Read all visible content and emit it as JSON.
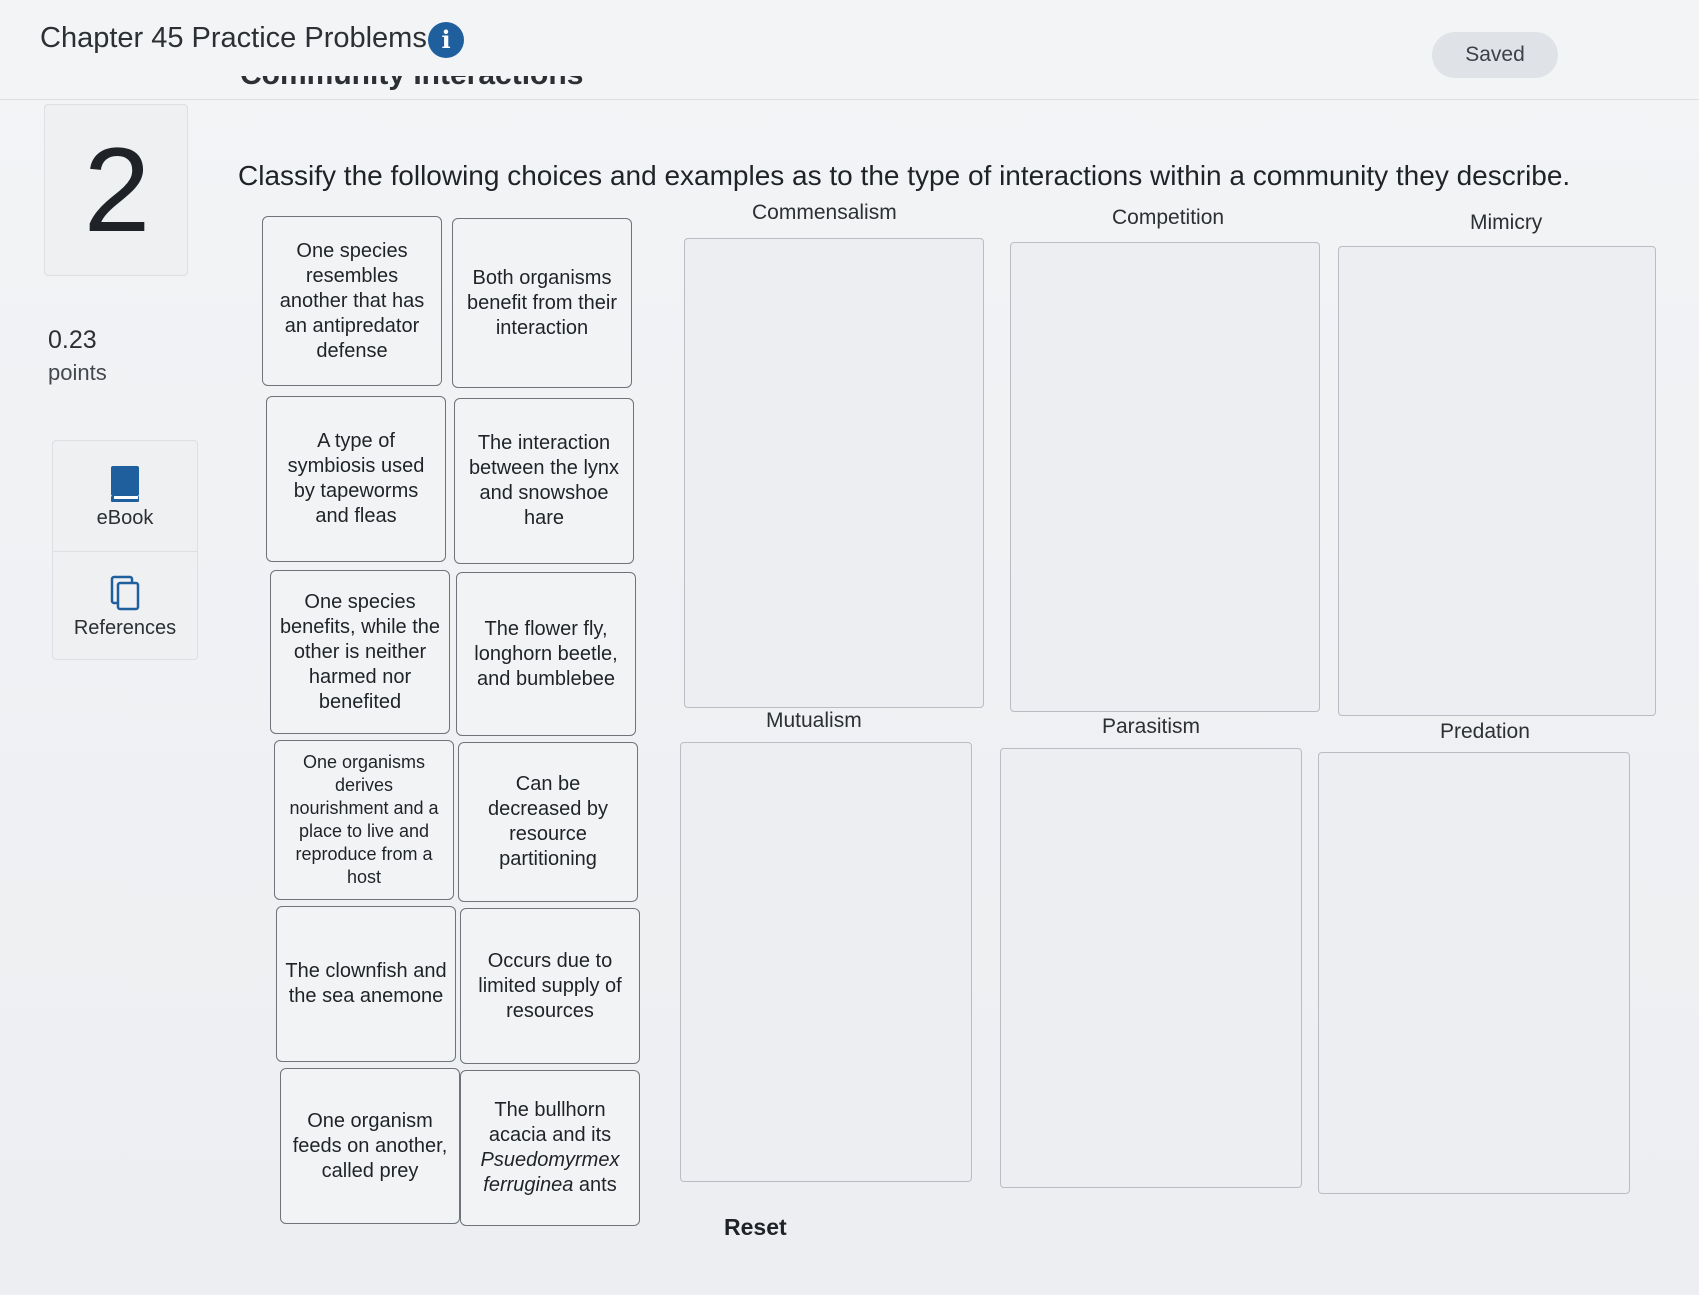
{
  "header": {
    "chapter_title": "Chapter 45 Practice Problems",
    "saved_label": "Saved",
    "section_heading": "Community Interactions"
  },
  "sidebar": {
    "question_number": "2",
    "points_value": "0.23",
    "points_label": "points",
    "tools": [
      {
        "label": "eBook",
        "icon": "book-icon"
      },
      {
        "label": "References",
        "icon": "documents-icon"
      }
    ]
  },
  "question": {
    "prompt": "Classify the following choices and examples as to the type of interactions within a community they describe."
  },
  "cards": [
    "One species resembles another that has an antipredator defense",
    "Both organisms benefit from their interaction",
    "A type of symbiosis used by tapeworms and fleas",
    "The interaction between the lynx and snowshoe hare",
    "One species benefits, while the other is neither harmed nor benefited",
    "The flower fly, longhorn beetle, and bumblebee",
    "One organisms derives nourishment and a place to live and reproduce from a host",
    "Can be decreased by resource partitioning",
    "The clownfish and the sea anemone",
    "Occurs due to limited supply of resources",
    "One organism feeds on another, called prey",
    "The bullhorn acacia and its Psuedomyrmex ferruginea ants"
  ],
  "zones": [
    "Commensalism",
    "Competition",
    "Mimicry",
    "Mutualism",
    "Parasitism",
    "Predation"
  ],
  "reset_label": "Reset",
  "colors": {
    "info_icon": "#1f5f9e",
    "ebook_icon": "#1f5f9e",
    "card_border": "#6e737a",
    "zone_border": "#b9bdc3"
  }
}
